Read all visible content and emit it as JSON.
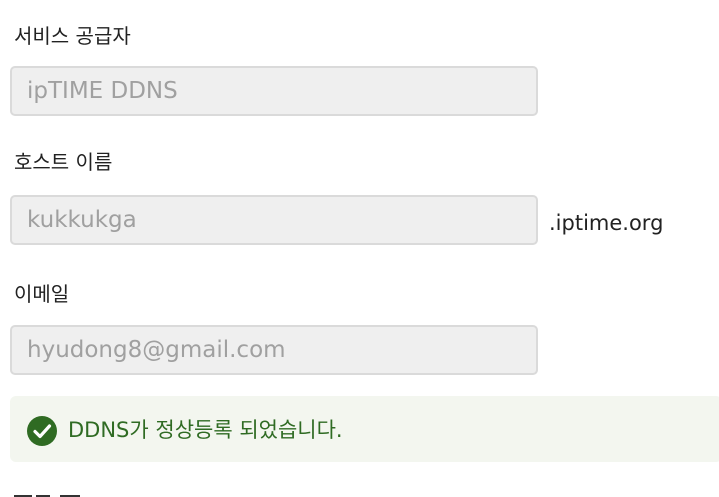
{
  "form": {
    "provider": {
      "label": "서비스 공급자",
      "placeholder": "ipTIME DDNS"
    },
    "hostname": {
      "label": "호스트 이름",
      "placeholder": "kukkukga",
      "suffix": ".iptime.org"
    },
    "email": {
      "label": "이메일",
      "placeholder": "hyudong8@gmail.com"
    }
  },
  "alert": {
    "icon": "check-circle-icon",
    "message": "DDNS가 정상등록 되었습니다.",
    "color": "#2f6b23"
  }
}
